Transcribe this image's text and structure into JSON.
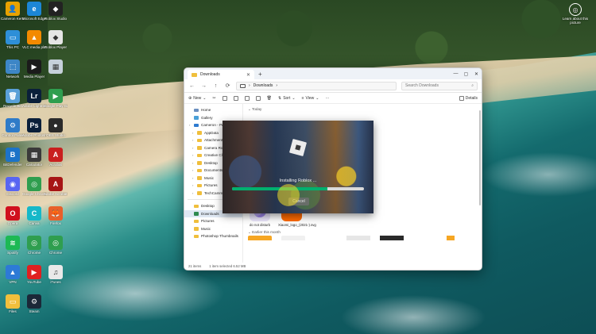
{
  "desktop": {
    "corner_icon": {
      "label": "Learn about this picture",
      "icon": "camera-icon"
    },
    "icons": [
      {
        "label": "Cameron Kenzie",
        "color": "#e8a200",
        "glyph": "👤"
      },
      {
        "label": "Microsoft Edge",
        "color": "#1c86d6",
        "glyph": "e"
      },
      {
        "label": "Roblox Studio",
        "color": "#222222",
        "glyph": "◆"
      },
      {
        "label": "This PC",
        "color": "#2e8fd8",
        "glyph": "▭"
      },
      {
        "label": "VLC media player",
        "color": "#f38a00",
        "glyph": "▲"
      },
      {
        "label": "Roblox Player",
        "color": "#e5e5e5",
        "glyph": "◆"
      },
      {
        "label": "Network",
        "color": "#3d86c6",
        "glyph": "⬚"
      },
      {
        "label": "Media Player",
        "color": "#1b1b1b",
        "glyph": "▶"
      },
      {
        "label": "",
        "color": "#c6d0da",
        "glyph": "▦"
      },
      {
        "label": "Recycle Bin",
        "color": "#5aa0d8",
        "glyph": "🗑"
      },
      {
        "label": "Adobe Lightroom",
        "color": "#0a1f3a",
        "glyph": "Lr"
      },
      {
        "label": "Google Play Games",
        "color": "#2f9e4f",
        "glyph": "▶"
      },
      {
        "label": "Control Panel",
        "color": "#2f7bc8",
        "glyph": "⚙"
      },
      {
        "label": "Adobe Photoshop",
        "color": "#0a1f3a",
        "glyph": "Ps"
      },
      {
        "label": "OBS Studio",
        "color": "#2a2a2a",
        "glyph": "●"
      },
      {
        "label": "BitDefender",
        "color": "#1c73c8",
        "glyph": "B"
      },
      {
        "label": "Calculator",
        "color": "#3a3a3a",
        "glyph": "▦"
      },
      {
        "label": "Acrobat",
        "color": "#c91f1f",
        "glyph": "A"
      },
      {
        "label": "Discord",
        "color": "#5865f2",
        "glyph": "◉"
      },
      {
        "label": "Google Chrome",
        "color": "#2f9e4f",
        "glyph": "◎"
      },
      {
        "label": "Adobe Acrobat DC",
        "color": "#a71515",
        "glyph": "A"
      },
      {
        "label": "Opera",
        "color": "#d0101e",
        "glyph": "O"
      },
      {
        "label": "Canva",
        "color": "#16b8c9",
        "glyph": "C"
      },
      {
        "label": "Firefox",
        "color": "#e8602a",
        "glyph": "🦊"
      },
      {
        "label": "Spotify",
        "color": "#1db954",
        "glyph": "≋"
      },
      {
        "label": "Chrome",
        "color": "#2f9e4f",
        "glyph": "◎"
      },
      {
        "label": "Chrome",
        "color": "#2f9e4f",
        "glyph": "◎"
      },
      {
        "label": "VPN",
        "color": "#2d7ad6",
        "glyph": "▲"
      },
      {
        "label": "YouTube",
        "color": "#e02020",
        "glyph": "▶"
      },
      {
        "label": "iTunes",
        "color": "#e9e9e9",
        "glyph": "♫"
      },
      {
        "label": "Files",
        "color": "#f0bf3c",
        "glyph": "▭"
      },
      {
        "label": "Steam",
        "color": "#1b2838",
        "glyph": "⚙"
      }
    ]
  },
  "window": {
    "tab_title": "Downloads",
    "controls": {
      "minimize": "—",
      "maximize": "▢",
      "close": "✕"
    },
    "nav": {
      "back": "←",
      "forward": "→",
      "up": "↑",
      "refresh": "⟳"
    },
    "address": "Downloads",
    "address_chevron": "›",
    "search_placeholder": "Search Downloads",
    "commands": {
      "new": "New",
      "sort": "Sort",
      "view": "View",
      "more": "···",
      "details": "Details"
    },
    "sidebar": [
      {
        "label": "Home",
        "type": "home"
      },
      {
        "label": "Gallery",
        "type": "gallery"
      },
      {
        "label": "Cameron - Pe",
        "type": "cloud"
      },
      {
        "label": "AppData",
        "type": "folder",
        "indent": true
      },
      {
        "label": "Attachments",
        "type": "folder",
        "indent": true
      },
      {
        "label": "Camera Roll",
        "type": "folder",
        "indent": true
      },
      {
        "label": "Creative Clo",
        "type": "folder",
        "indent": true
      },
      {
        "label": "Desktop",
        "type": "folder",
        "indent": true
      },
      {
        "label": "Documents",
        "type": "folder",
        "indent": true
      },
      {
        "label": "Music",
        "type": "folder",
        "indent": true
      },
      {
        "label": "Pictures",
        "type": "folder",
        "indent": true
      },
      {
        "label": "TechCamme",
        "type": "folder",
        "indent": true
      },
      {
        "label": "Desktop",
        "type": "folder",
        "sep_before": true
      },
      {
        "label": "Downloads",
        "type": "download",
        "selected": true
      },
      {
        "label": "Pictures",
        "type": "folder"
      },
      {
        "label": "Music",
        "type": "folder"
      },
      {
        "label": "Photoshop Thumbnails",
        "type": "folder"
      }
    ],
    "content": {
      "group_today": "Today",
      "group_earlier": "Earlier this month",
      "files": [
        {
          "name": "do not disturb",
          "color": "#b9a7f2"
        },
        {
          "name": "Xiaomi_logo_(2021-).svg",
          "color": "#ff6a00",
          "glyph": "mi"
        }
      ]
    },
    "status": {
      "items": "21 items",
      "selected": "1 item selected  6.52 MB"
    }
  },
  "installer": {
    "message": "Installing Roblox ...",
    "cancel": "Cancel",
    "progress": 0.72,
    "accent": "#00b06f"
  }
}
